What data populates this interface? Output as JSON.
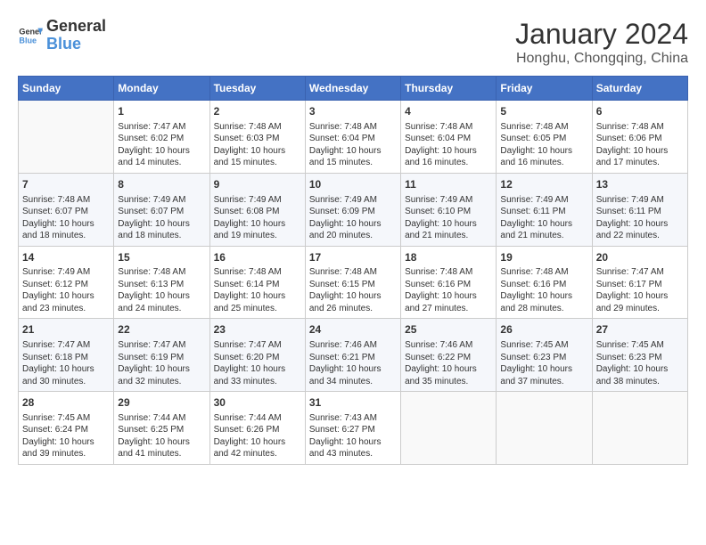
{
  "logo": {
    "line1": "General",
    "line2": "Blue"
  },
  "title": "January 2024",
  "location": "Honghu, Chongqing, China",
  "days_of_week": [
    "Sunday",
    "Monday",
    "Tuesday",
    "Wednesday",
    "Thursday",
    "Friday",
    "Saturday"
  ],
  "weeks": [
    [
      {
        "day": "",
        "info": ""
      },
      {
        "day": "1",
        "info": "Sunrise: 7:47 AM\nSunset: 6:02 PM\nDaylight: 10 hours\nand 14 minutes."
      },
      {
        "day": "2",
        "info": "Sunrise: 7:48 AM\nSunset: 6:03 PM\nDaylight: 10 hours\nand 15 minutes."
      },
      {
        "day": "3",
        "info": "Sunrise: 7:48 AM\nSunset: 6:04 PM\nDaylight: 10 hours\nand 15 minutes."
      },
      {
        "day": "4",
        "info": "Sunrise: 7:48 AM\nSunset: 6:04 PM\nDaylight: 10 hours\nand 16 minutes."
      },
      {
        "day": "5",
        "info": "Sunrise: 7:48 AM\nSunset: 6:05 PM\nDaylight: 10 hours\nand 16 minutes."
      },
      {
        "day": "6",
        "info": "Sunrise: 7:48 AM\nSunset: 6:06 PM\nDaylight: 10 hours\nand 17 minutes."
      }
    ],
    [
      {
        "day": "7",
        "info": "Sunrise: 7:48 AM\nSunset: 6:07 PM\nDaylight: 10 hours\nand 18 minutes."
      },
      {
        "day": "8",
        "info": "Sunrise: 7:49 AM\nSunset: 6:07 PM\nDaylight: 10 hours\nand 18 minutes."
      },
      {
        "day": "9",
        "info": "Sunrise: 7:49 AM\nSunset: 6:08 PM\nDaylight: 10 hours\nand 19 minutes."
      },
      {
        "day": "10",
        "info": "Sunrise: 7:49 AM\nSunset: 6:09 PM\nDaylight: 10 hours\nand 20 minutes."
      },
      {
        "day": "11",
        "info": "Sunrise: 7:49 AM\nSunset: 6:10 PM\nDaylight: 10 hours\nand 21 minutes."
      },
      {
        "day": "12",
        "info": "Sunrise: 7:49 AM\nSunset: 6:11 PM\nDaylight: 10 hours\nand 21 minutes."
      },
      {
        "day": "13",
        "info": "Sunrise: 7:49 AM\nSunset: 6:11 PM\nDaylight: 10 hours\nand 22 minutes."
      }
    ],
    [
      {
        "day": "14",
        "info": "Sunrise: 7:49 AM\nSunset: 6:12 PM\nDaylight: 10 hours\nand 23 minutes."
      },
      {
        "day": "15",
        "info": "Sunrise: 7:48 AM\nSunset: 6:13 PM\nDaylight: 10 hours\nand 24 minutes."
      },
      {
        "day": "16",
        "info": "Sunrise: 7:48 AM\nSunset: 6:14 PM\nDaylight: 10 hours\nand 25 minutes."
      },
      {
        "day": "17",
        "info": "Sunrise: 7:48 AM\nSunset: 6:15 PM\nDaylight: 10 hours\nand 26 minutes."
      },
      {
        "day": "18",
        "info": "Sunrise: 7:48 AM\nSunset: 6:16 PM\nDaylight: 10 hours\nand 27 minutes."
      },
      {
        "day": "19",
        "info": "Sunrise: 7:48 AM\nSunset: 6:16 PM\nDaylight: 10 hours\nand 28 minutes."
      },
      {
        "day": "20",
        "info": "Sunrise: 7:47 AM\nSunset: 6:17 PM\nDaylight: 10 hours\nand 29 minutes."
      }
    ],
    [
      {
        "day": "21",
        "info": "Sunrise: 7:47 AM\nSunset: 6:18 PM\nDaylight: 10 hours\nand 30 minutes."
      },
      {
        "day": "22",
        "info": "Sunrise: 7:47 AM\nSunset: 6:19 PM\nDaylight: 10 hours\nand 32 minutes."
      },
      {
        "day": "23",
        "info": "Sunrise: 7:47 AM\nSunset: 6:20 PM\nDaylight: 10 hours\nand 33 minutes."
      },
      {
        "day": "24",
        "info": "Sunrise: 7:46 AM\nSunset: 6:21 PM\nDaylight: 10 hours\nand 34 minutes."
      },
      {
        "day": "25",
        "info": "Sunrise: 7:46 AM\nSunset: 6:22 PM\nDaylight: 10 hours\nand 35 minutes."
      },
      {
        "day": "26",
        "info": "Sunrise: 7:45 AM\nSunset: 6:23 PM\nDaylight: 10 hours\nand 37 minutes."
      },
      {
        "day": "27",
        "info": "Sunrise: 7:45 AM\nSunset: 6:23 PM\nDaylight: 10 hours\nand 38 minutes."
      }
    ],
    [
      {
        "day": "28",
        "info": "Sunrise: 7:45 AM\nSunset: 6:24 PM\nDaylight: 10 hours\nand 39 minutes."
      },
      {
        "day": "29",
        "info": "Sunrise: 7:44 AM\nSunset: 6:25 PM\nDaylight: 10 hours\nand 41 minutes."
      },
      {
        "day": "30",
        "info": "Sunrise: 7:44 AM\nSunset: 6:26 PM\nDaylight: 10 hours\nand 42 minutes."
      },
      {
        "day": "31",
        "info": "Sunrise: 7:43 AM\nSunset: 6:27 PM\nDaylight: 10 hours\nand 43 minutes."
      },
      {
        "day": "",
        "info": ""
      },
      {
        "day": "",
        "info": ""
      },
      {
        "day": "",
        "info": ""
      }
    ]
  ]
}
